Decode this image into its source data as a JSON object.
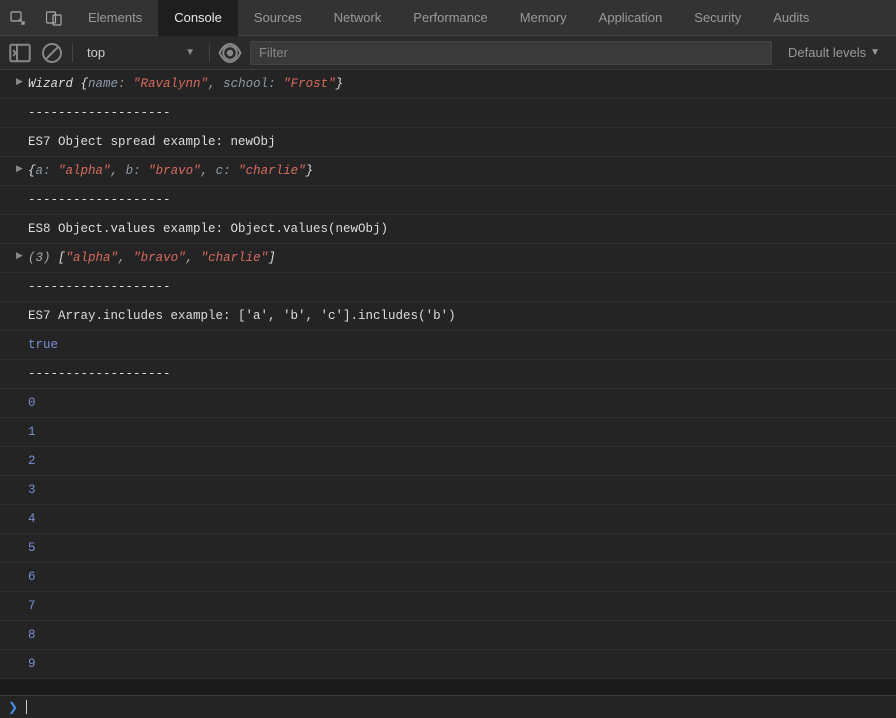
{
  "tabs": [
    "Elements",
    "Console",
    "Sources",
    "Network",
    "Performance",
    "Memory",
    "Application",
    "Security",
    "Audits"
  ],
  "active_tab": "Console",
  "toolbar": {
    "context": "top",
    "filter_placeholder": "Filter",
    "levels": "Default levels"
  },
  "log": [
    {
      "type": "object",
      "proto": "Wizard",
      "pairs": [
        [
          "name",
          "\"Ravalynn\""
        ],
        [
          "school",
          "\"Frost\""
        ]
      ]
    },
    {
      "type": "text",
      "text": "-------------------"
    },
    {
      "type": "text",
      "text": "ES7 Object spread example: newObj"
    },
    {
      "type": "object",
      "proto": "",
      "pairs": [
        [
          "a",
          "\"alpha\""
        ],
        [
          "b",
          "\"bravo\""
        ],
        [
          "c",
          "\"charlie\""
        ]
      ]
    },
    {
      "type": "text",
      "text": "-------------------"
    },
    {
      "type": "text",
      "text": "ES8 Object.values example: Object.values(newObj)"
    },
    {
      "type": "array",
      "len": 3,
      "items": [
        "\"alpha\"",
        "\"bravo\"",
        "\"charlie\""
      ]
    },
    {
      "type": "text",
      "text": "-------------------"
    },
    {
      "type": "text",
      "text": "ES7 Array.includes example: ['a', 'b', 'c'].includes('b')"
    },
    {
      "type": "bool",
      "value": "true"
    },
    {
      "type": "text",
      "text": "-------------------"
    },
    {
      "type": "num",
      "value": "0"
    },
    {
      "type": "num",
      "value": "1"
    },
    {
      "type": "num",
      "value": "2"
    },
    {
      "type": "num",
      "value": "3"
    },
    {
      "type": "num",
      "value": "4"
    },
    {
      "type": "num",
      "value": "5"
    },
    {
      "type": "num",
      "value": "6"
    },
    {
      "type": "num",
      "value": "7"
    },
    {
      "type": "num",
      "value": "8"
    },
    {
      "type": "num",
      "value": "9"
    }
  ]
}
